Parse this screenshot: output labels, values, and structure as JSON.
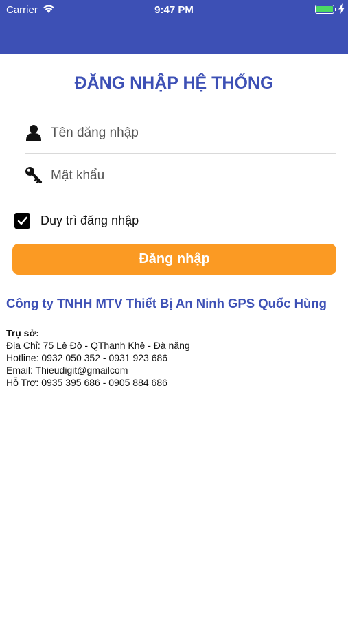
{
  "status_bar": {
    "carrier": "Carrier",
    "time": "9:47 PM",
    "battery_percent": 100
  },
  "header": {
    "color": "#3d50b5"
  },
  "login": {
    "title": "ĐĂNG NHẬP HỆ THỐNG",
    "username_placeholder": "Tên đăng nhập",
    "username_icon": "user-icon",
    "password_placeholder": "Mật khẩu",
    "password_icon": "key-icon",
    "remember_label": "Duy trì đăng nhập",
    "remember_checked": true,
    "submit_label": "Đăng nhập",
    "button_color": "#fb9a23"
  },
  "company": {
    "name": "Công ty TNHH MTV Thiết Bị An Ninh GPS Quốc Hùng",
    "office_label": "Trụ sở:",
    "address": "Địa Chỉ: 75 Lê Độ - QThanh Khê - Đà nẵng",
    "hotline": "Hotline: 0932 050 352 - 0931 923 686",
    "email": "Email: Thieudigit@gmailcom",
    "support": "Hỗ Trợ: 0935 395 686 - 0905 884 686"
  }
}
